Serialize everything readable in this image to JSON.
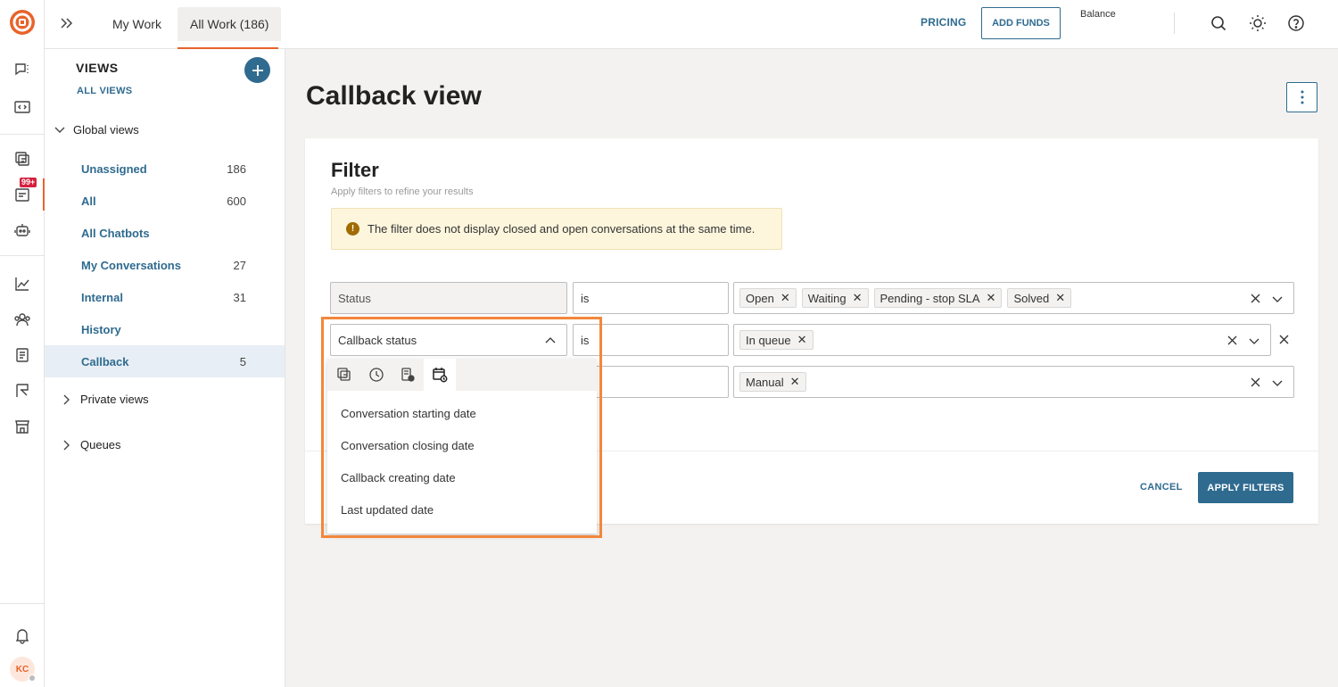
{
  "topbar": {
    "tabs": [
      "My Work",
      "All Work (186)"
    ],
    "pricing": "PRICING",
    "add_funds": "ADD FUNDS",
    "balance": "Balance"
  },
  "rail": {
    "badge": "99+",
    "avatar": "KC"
  },
  "views": {
    "title": "VIEWS",
    "all_views": "ALL VIEWS",
    "global_views": "Global views",
    "items": [
      {
        "label": "Unassigned",
        "count": "186"
      },
      {
        "label": "All",
        "count": "600"
      },
      {
        "label": "All Chatbots",
        "count": ""
      },
      {
        "label": "My Conversations",
        "count": "27"
      },
      {
        "label": "Internal",
        "count": "31"
      },
      {
        "label": "History",
        "count": ""
      },
      {
        "label": "Callback",
        "count": "5"
      }
    ],
    "private_views": "Private views",
    "queues": "Queues"
  },
  "page": {
    "title": "Callback view"
  },
  "filter": {
    "title": "Filter",
    "subtitle": "Apply filters to refine your results",
    "warning": "The filter does not display closed and open conversations at the same time.",
    "rows": [
      {
        "field": "Status",
        "operator": "is",
        "values": [
          "Open",
          "Waiting",
          "Pending - stop SLA",
          "Solved"
        ]
      },
      {
        "field": "Callback status",
        "operator": "is",
        "values": [
          "In queue"
        ]
      },
      {
        "field": "",
        "operator": "",
        "values": [
          "Manual"
        ]
      }
    ],
    "cancel": "CANCEL",
    "apply": "APPLY FILTERS"
  },
  "dropdown": {
    "tab_icons": [
      "conversation-icon",
      "clock-icon",
      "document-status-icon",
      "calendar-clock-icon"
    ],
    "options": [
      "Conversation starting date",
      "Conversation closing date",
      "Callback creating date",
      "Last updated date"
    ]
  },
  "colors": {
    "accent": "#2f6b8f",
    "brand": "#e8632b",
    "highlight": "#f2873c",
    "badge": "#d4213d"
  }
}
